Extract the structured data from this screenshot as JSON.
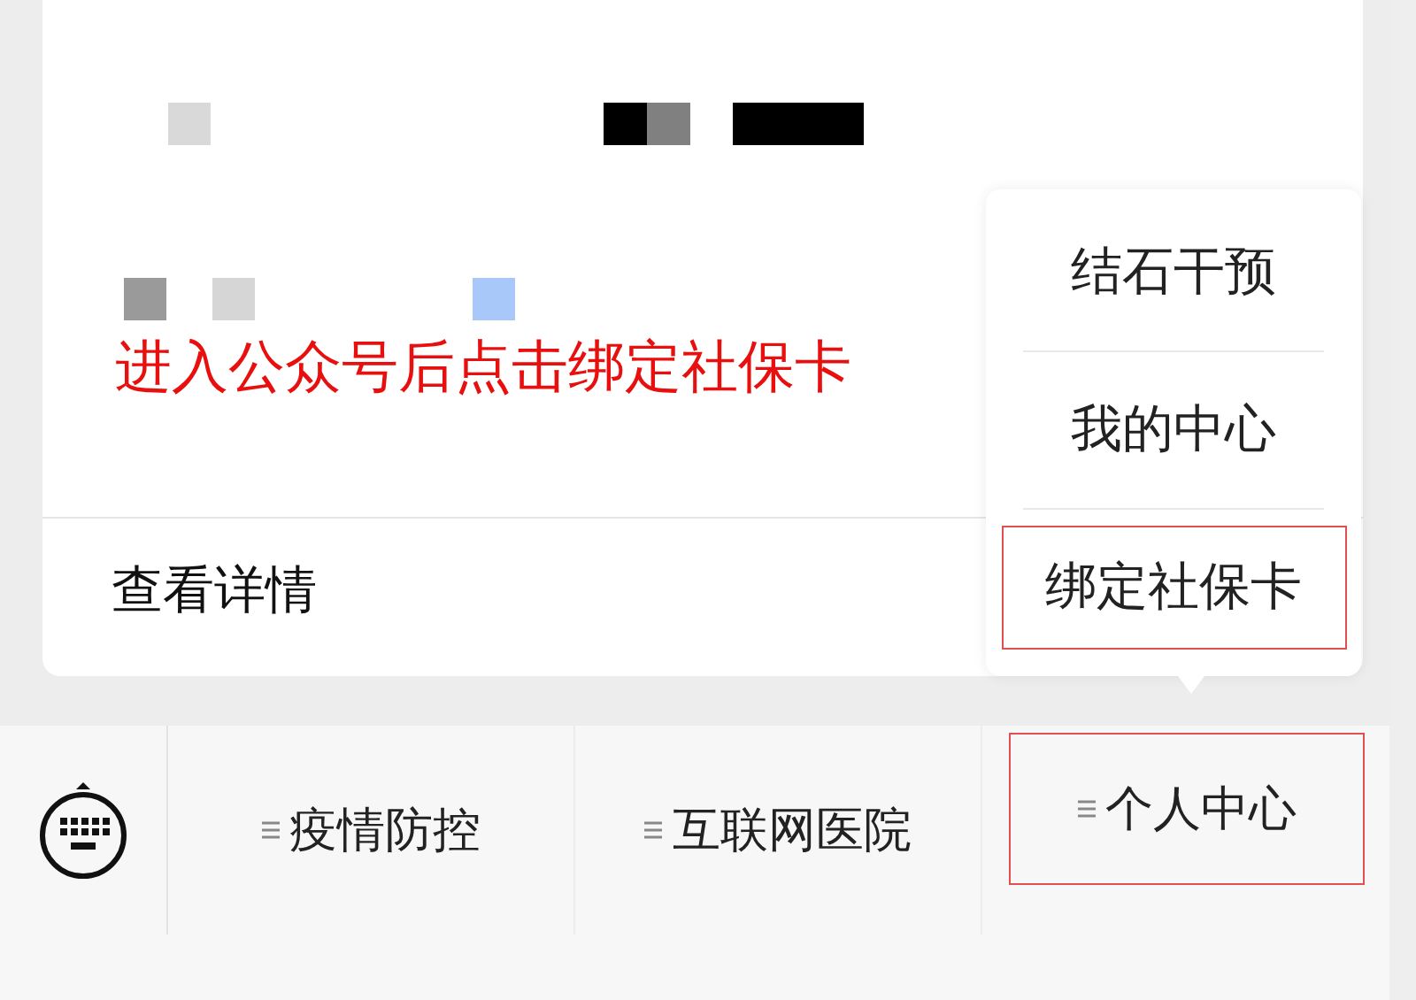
{
  "card": {
    "annotation": "进入公众号后点击绑定社保卡",
    "link": "查看详情"
  },
  "popup_menu": {
    "items": [
      {
        "label": "结石干预",
        "highlighted": false
      },
      {
        "label": "我的中心",
        "highlighted": false
      },
      {
        "label": "绑定社保卡",
        "highlighted": true
      }
    ]
  },
  "menu_bar": {
    "items": [
      {
        "label": "疫情防控",
        "highlighted": false
      },
      {
        "label": "互联网医院",
        "highlighted": false
      },
      {
        "label": "个人中心",
        "highlighted": true
      }
    ]
  }
}
